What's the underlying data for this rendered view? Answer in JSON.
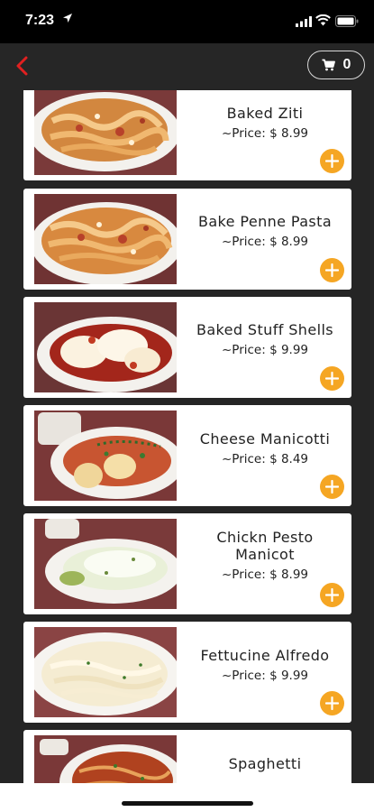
{
  "status_bar": {
    "time": "7:23"
  },
  "nav": {
    "cart_count": "0"
  },
  "menu_items": [
    {
      "name": "Baked Ziti",
      "price": "~Price: $ 8.99",
      "photo_icon": "baked-ziti-photo"
    },
    {
      "name": "Bake Penne Pasta",
      "price": "~Price: $ 8.99",
      "photo_icon": "penne-pasta-photo"
    },
    {
      "name": "Baked Stuff Shells",
      "price": "~Price: $ 9.99",
      "photo_icon": "stuffed-shells-photo"
    },
    {
      "name": "Cheese Manicotti",
      "price": "~Price: $ 8.49",
      "photo_icon": "manicotti-photo"
    },
    {
      "name": "Chickn Pesto Manicot",
      "price": "~Price: $ 8.99",
      "photo_icon": "pesto-manicotti-photo"
    },
    {
      "name": "Fettucine Alfredo",
      "price": "~Price: $ 9.99",
      "photo_icon": "fettucine-alfredo-photo"
    },
    {
      "name": "Spaghetti",
      "price": "",
      "photo_icon": "spaghetti-photo"
    }
  ],
  "colors": {
    "accent_back": "#e02020",
    "add_button": "#f5a623",
    "background": "#252525"
  }
}
